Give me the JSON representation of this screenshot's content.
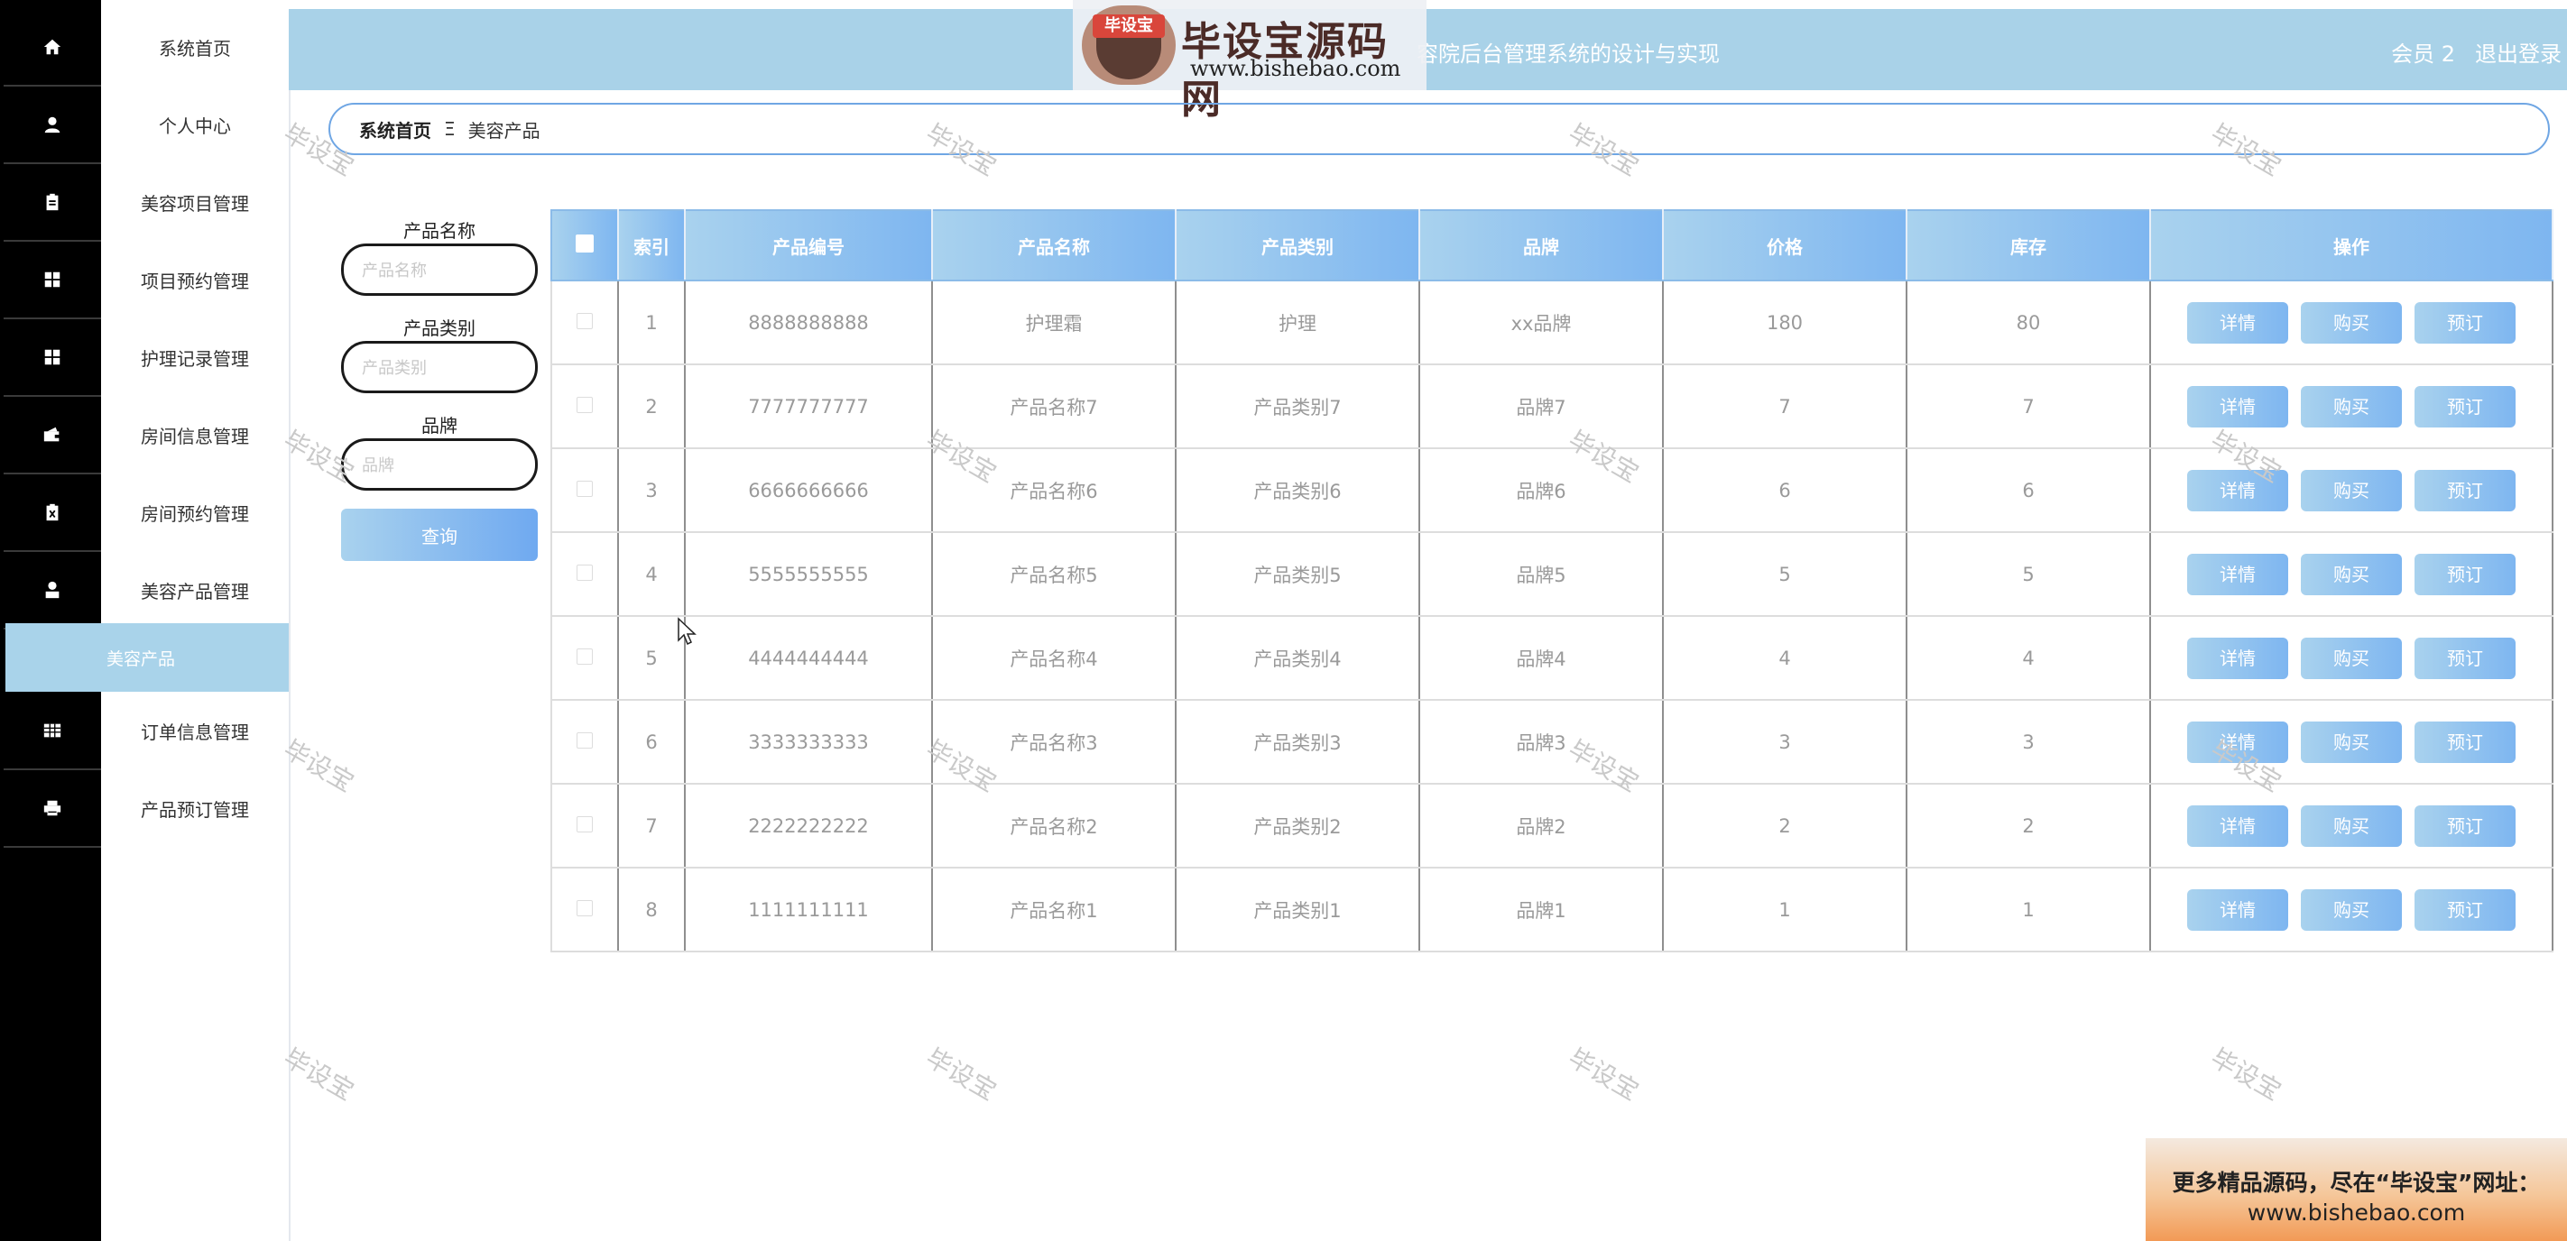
{
  "sidebar": {
    "items": [
      {
        "label": "系统首页",
        "icon": "home-icon"
      },
      {
        "label": "个人中心",
        "icon": "user-icon"
      },
      {
        "label": "美容项目管理",
        "icon": "clipboard-icon"
      },
      {
        "label": "项目预约管理",
        "icon": "grid-icon"
      },
      {
        "label": "护理记录管理",
        "icon": "grid-icon"
      },
      {
        "label": "房间信息管理",
        "icon": "wallet-icon"
      },
      {
        "label": "房间预约管理",
        "icon": "clipboard-x-icon"
      },
      {
        "label": "美容产品管理",
        "icon": "person-icon"
      },
      {
        "label": "订单信息管理",
        "icon": "table-icon"
      },
      {
        "label": "产品预订管理",
        "icon": "printer-icon"
      }
    ],
    "submenu_active": "美容产品"
  },
  "header": {
    "title": "容院后台管理系统的设计与实现",
    "user": "会员 2",
    "logout": "退出登录"
  },
  "logo": {
    "badge_text": "毕设宝",
    "site_name": "毕设宝源码网",
    "url": "www.bishebao.com"
  },
  "breadcrumb": {
    "home": "系统首页",
    "separator": "Ξ",
    "current": "美容产品"
  },
  "filters": {
    "name_label": "产品名称",
    "name_placeholder": "产品名称",
    "category_label": "产品类别",
    "category_placeholder": "产品类别",
    "brand_label": "品牌",
    "brand_placeholder": "品牌",
    "query_button": "查询"
  },
  "table": {
    "headers": [
      "索引",
      "产品编号",
      "产品名称",
      "产品类别",
      "品牌",
      "价格",
      "库存",
      "操作"
    ],
    "actions": [
      "详情",
      "购买",
      "预订"
    ],
    "rows": [
      [
        "1",
        "8888888888",
        "护理霜",
        "护理",
        "xx品牌",
        "180",
        "80"
      ],
      [
        "2",
        "7777777777",
        "产品名称7",
        "产品类别7",
        "品牌7",
        "7",
        "7"
      ],
      [
        "3",
        "6666666666",
        "产品名称6",
        "产品类别6",
        "品牌6",
        "6",
        "6"
      ],
      [
        "4",
        "5555555555",
        "产品名称5",
        "产品类别5",
        "品牌5",
        "5",
        "5"
      ],
      [
        "5",
        "4444444444",
        "产品名称4",
        "产品类别4",
        "品牌4",
        "4",
        "4"
      ],
      [
        "6",
        "3333333333",
        "产品名称3",
        "产品类别3",
        "品牌3",
        "3",
        "3"
      ],
      [
        "7",
        "2222222222",
        "产品名称2",
        "产品类别2",
        "品牌2",
        "2",
        "2"
      ],
      [
        "8",
        "1111111111",
        "产品名称1",
        "产品类别1",
        "品牌1",
        "1",
        "1"
      ]
    ]
  },
  "watermark": "毕设宝",
  "promo": {
    "line1": "更多精品源码，尽在“毕设宝”网址：",
    "line2": "www.bishebao.com"
  },
  "colors": {
    "header_bg": "#a9d2e8",
    "accent_blue": "#7eb6f0",
    "icon_bar": "#000000"
  }
}
